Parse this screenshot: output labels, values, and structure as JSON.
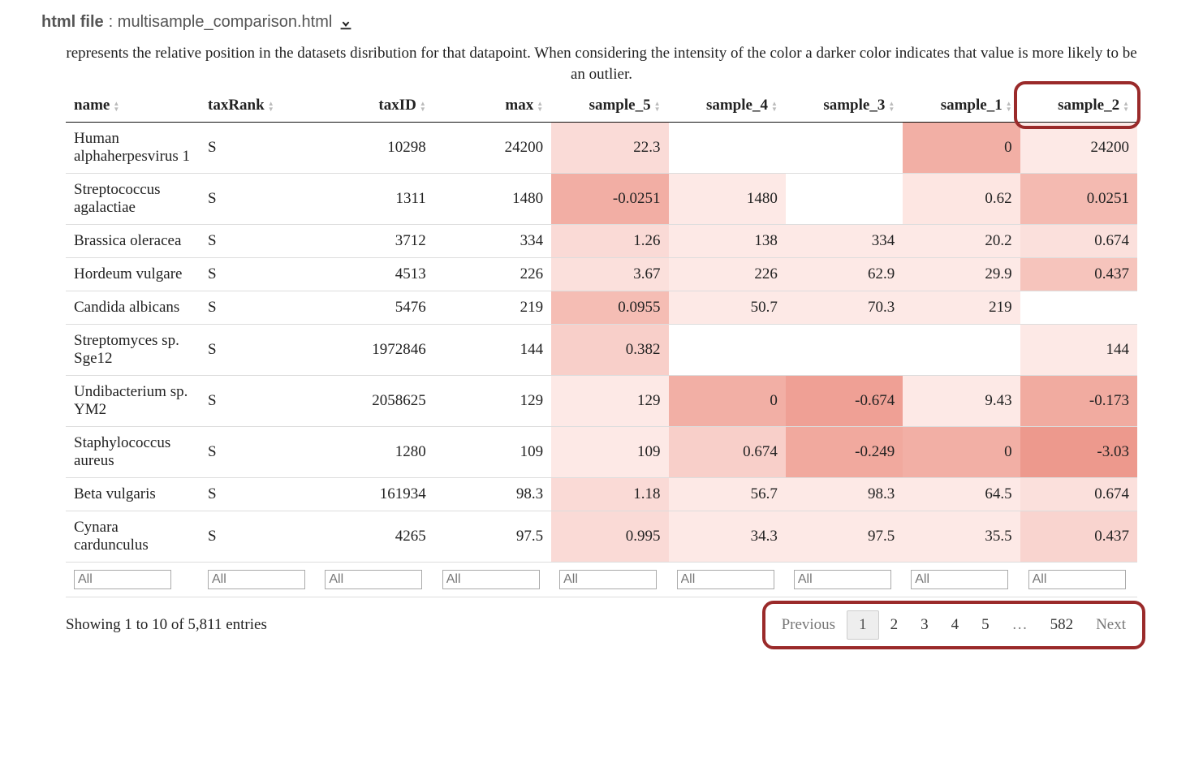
{
  "file_label": "html file",
  "file_name": ": multisample_comparison.html",
  "description": "represents the relative position in the datasets disribution for that datapoint. When considering the intensity of the color a darker color indicates that value is more likely to be an outlier.",
  "columns": [
    "name",
    "taxRank",
    "taxID",
    "max",
    "sample_5",
    "sample_4",
    "sample_3",
    "sample_1",
    "sample_2"
  ],
  "filter_placeholder": "All",
  "rows": [
    {
      "name": "Human alphaherpesvirus 1",
      "taxRank": "S",
      "taxID": "10298",
      "max": "24200",
      "cells": [
        {
          "v": "22.3",
          "bg": "#fadbd7"
        },
        {
          "v": "",
          "bg": "#ffffff"
        },
        {
          "v": "",
          "bg": "#ffffff"
        },
        {
          "v": "0",
          "bg": "#f2afa5"
        },
        {
          "v": "24200",
          "bg": "#fde9e6"
        }
      ]
    },
    {
      "name": "Streptococcus agalactiae",
      "taxRank": "S",
      "taxID": "1311",
      "max": "1480",
      "cells": [
        {
          "v": "-0.0251",
          "bg": "#f2aea4"
        },
        {
          "v": "1480",
          "bg": "#fde9e6"
        },
        {
          "v": "",
          "bg": "#ffffff"
        },
        {
          "v": "0.62",
          "bg": "#fde6e2"
        },
        {
          "v": "0.0251",
          "bg": "#f4bab1"
        }
      ]
    },
    {
      "name": "Brassica oleracea",
      "taxRank": "S",
      "taxID": "3712",
      "max": "334",
      "cells": [
        {
          "v": "1.26",
          "bg": "#fadad6"
        },
        {
          "v": "138",
          "bg": "#fde9e6"
        },
        {
          "v": "334",
          "bg": "#fde9e6"
        },
        {
          "v": "20.2",
          "bg": "#fde9e6"
        },
        {
          "v": "0.674",
          "bg": "#fbe0dc"
        }
      ]
    },
    {
      "name": "Hordeum vulgare",
      "taxRank": "S",
      "taxID": "4513",
      "max": "226",
      "cells": [
        {
          "v": "3.67",
          "bg": "#fbe0dc"
        },
        {
          "v": "226",
          "bg": "#fde9e6"
        },
        {
          "v": "62.9",
          "bg": "#fde9e6"
        },
        {
          "v": "29.9",
          "bg": "#fde9e6"
        },
        {
          "v": "0.437",
          "bg": "#f6c4bc"
        }
      ]
    },
    {
      "name": "Candida albicans",
      "taxRank": "S",
      "taxID": "5476",
      "max": "219",
      "cells": [
        {
          "v": "0.0955",
          "bg": "#f5bdb4"
        },
        {
          "v": "50.7",
          "bg": "#fde9e6"
        },
        {
          "v": "70.3",
          "bg": "#fde9e6"
        },
        {
          "v": "219",
          "bg": "#fde9e6"
        },
        {
          "v": "",
          "bg": "#ffffff"
        }
      ]
    },
    {
      "name": "Streptomyces sp. Sge12",
      "taxRank": "S",
      "taxID": "1972846",
      "max": "144",
      "cells": [
        {
          "v": "0.382",
          "bg": "#f8cfc9"
        },
        {
          "v": "",
          "bg": "#ffffff"
        },
        {
          "v": "",
          "bg": "#ffffff"
        },
        {
          "v": "",
          "bg": "#ffffff"
        },
        {
          "v": "144",
          "bg": "#fde9e6"
        }
      ]
    },
    {
      "name": "Undibacterium sp. YM2",
      "taxRank": "S",
      "taxID": "2058625",
      "max": "129",
      "cells": [
        {
          "v": "129",
          "bg": "#fde9e6"
        },
        {
          "v": "0",
          "bg": "#f2afa5"
        },
        {
          "v": "-0.674",
          "bg": "#efa095"
        },
        {
          "v": "9.43",
          "bg": "#fde9e6"
        },
        {
          "v": "-0.173",
          "bg": "#f1aba0"
        }
      ]
    },
    {
      "name": "Staphylococcus aureus",
      "taxRank": "S",
      "taxID": "1280",
      "max": "109",
      "cells": [
        {
          "v": "109",
          "bg": "#fde9e6"
        },
        {
          "v": "0.674",
          "bg": "#f8cfc9"
        },
        {
          "v": "-0.249",
          "bg": "#f1a99e"
        },
        {
          "v": "0",
          "bg": "#f2afa5"
        },
        {
          "v": "-3.03",
          "bg": "#ed998d"
        }
      ]
    },
    {
      "name": "Beta vulgaris",
      "taxRank": "S",
      "taxID": "161934",
      "max": "98.3",
      "cells": [
        {
          "v": "1.18",
          "bg": "#fadad6"
        },
        {
          "v": "56.7",
          "bg": "#fde9e6"
        },
        {
          "v": "98.3",
          "bg": "#fde9e6"
        },
        {
          "v": "64.5",
          "bg": "#fde9e6"
        },
        {
          "v": "0.674",
          "bg": "#fbe0dc"
        }
      ]
    },
    {
      "name": "Cynara cardunculus",
      "taxRank": "S",
      "taxID": "4265",
      "max": "97.5",
      "cells": [
        {
          "v": "0.995",
          "bg": "#fadad6"
        },
        {
          "v": "34.3",
          "bg": "#fde9e6"
        },
        {
          "v": "97.5",
          "bg": "#fde9e6"
        },
        {
          "v": "35.5",
          "bg": "#fde9e6"
        },
        {
          "v": "0.437",
          "bg": "#f9d4cf"
        }
      ]
    }
  ],
  "info_text": "Showing 1 to 10 of 5,811 entries",
  "pagination": {
    "prev": "Previous",
    "next": "Next",
    "pages": [
      "1",
      "2",
      "3",
      "4",
      "5",
      "…",
      "582"
    ],
    "active_index": 0
  }
}
